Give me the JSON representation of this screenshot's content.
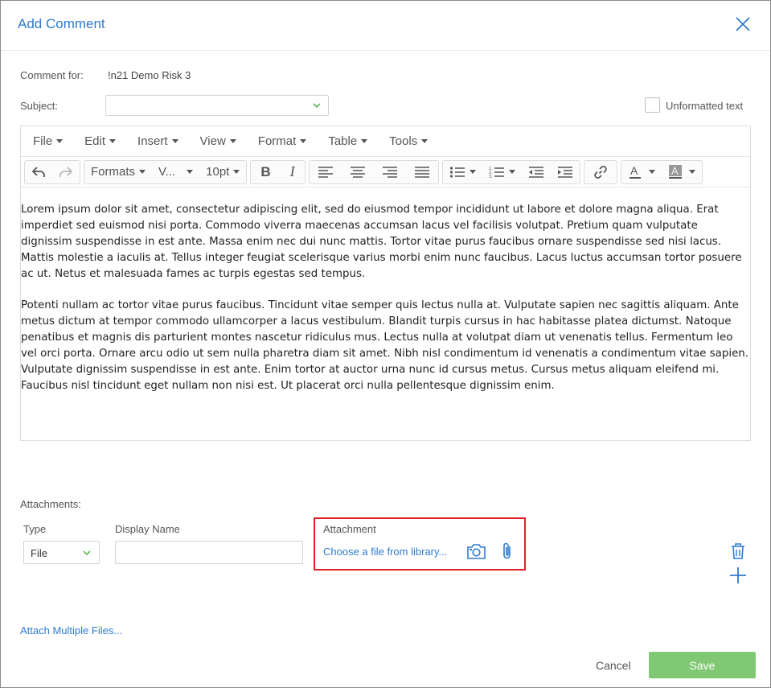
{
  "dialog": {
    "title": "Add Comment"
  },
  "form": {
    "comment_for_label": "Comment for:",
    "comment_for_value": "!n21 Demo Risk 3",
    "subject_label": "Subject:",
    "subject_value": "",
    "unformatted_label": "Unformatted text"
  },
  "editor": {
    "menus": [
      "File",
      "Edit",
      "Insert",
      "View",
      "Format",
      "Table",
      "Tools"
    ],
    "toolbar": {
      "formats": "Formats",
      "font": "V...",
      "size": "10pt",
      "bold": "B",
      "italic": "I"
    },
    "paragraphs": [
      "Lorem ipsum dolor sit amet, consectetur adipiscing elit, sed do eiusmod tempor incididunt ut labore et dolore magna aliqua. Erat imperdiet sed euismod nisi porta. Commodo viverra maecenas accumsan lacus vel facilisis volutpat. Pretium quam vulputate dignissim suspendisse in est ante. Massa enim nec dui nunc mattis. Tortor vitae purus faucibus ornare suspendisse sed nisi lacus. Mattis molestie a iaculis at. Tellus integer feugiat scelerisque varius morbi enim nunc faucibus. Lacus luctus accumsan tortor posuere ac ut. Netus et malesuada fames ac turpis egestas sed tempus.",
      "Potenti nullam ac tortor vitae purus faucibus. Tincidunt vitae semper quis lectus nulla at. Vulputate sapien nec sagittis aliquam. Ante metus dictum at tempor commodo ullamcorper a lacus vestibulum. Blandit turpis cursus in hac habitasse platea dictumst. Natoque penatibus et magnis dis parturient montes nascetur ridiculus mus. Lectus nulla at volutpat diam ut venenatis tellus. Fermentum leo vel orci porta. Ornare arcu odio ut sem nulla pharetra diam sit amet. Nibh nisl condimentum id venenatis a condimentum vitae sapien. Vulputate dignissim suspendisse in est ante. Enim tortor at auctor urna nunc id cursus metus. Cursus metus aliquam eleifend mi. Faucibus nisl tincidunt eget nullam non nisi est. Ut placerat orci nulla pellentesque dignissim enim."
    ]
  },
  "attachments": {
    "section_label": "Attachments:",
    "type_label": "Type",
    "type_value": "File",
    "display_name_label": "Display Name",
    "display_name_value": "",
    "attachment_label": "Attachment",
    "choose_file_link": "Choose a file from library...",
    "attach_multiple_link": "Attach Multiple Files..."
  },
  "actions": {
    "cancel": "Cancel",
    "save": "Save"
  },
  "colors": {
    "accent": "#2e7bd1",
    "save": "#80c873",
    "highlight": "#e01e24"
  }
}
